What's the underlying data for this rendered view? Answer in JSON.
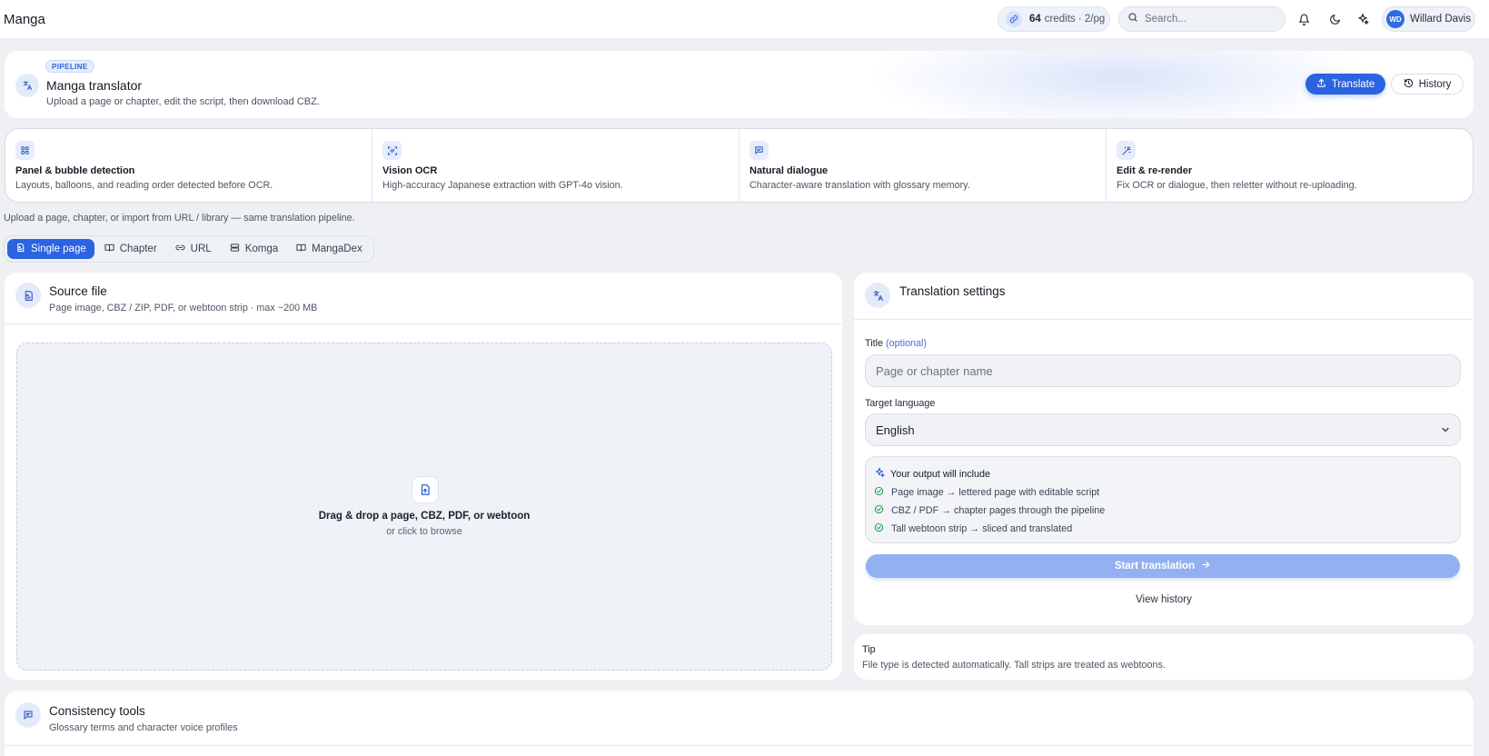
{
  "app": {
    "brand": "Manga"
  },
  "topbar": {
    "credits_value": "64",
    "credits_rest": "credits · 2/pg",
    "search_placeholder": "Search...",
    "user": {
      "initials": "WD",
      "name": "Willard Davis"
    }
  },
  "hero": {
    "badge": "PIPELINE",
    "title": "Manga translator",
    "subtitle": "Upload a page or chapter, edit the script, then download CBZ.",
    "translate_label": "Translate",
    "history_label": "History"
  },
  "features": [
    {
      "title": "Panel & bubble detection",
      "desc": "Layouts, balloons, and reading order detected before OCR.",
      "icon": "grid-icon"
    },
    {
      "title": "Vision OCR",
      "desc": "High-accuracy Japanese extraction with GPT-4o vision.",
      "icon": "scan-text-icon"
    },
    {
      "title": "Natural dialogue",
      "desc": "Character-aware translation with glossary memory.",
      "icon": "message-icon"
    },
    {
      "title": "Edit & re-render",
      "desc": "Fix OCR or dialogue, then reletter without re-uploading.",
      "icon": "wand-icon"
    }
  ],
  "hint": "Upload a page, chapter, or import from URL / library — same translation pipeline.",
  "tabs": [
    {
      "label": "Single page",
      "active": true
    },
    {
      "label": "Chapter",
      "active": false
    },
    {
      "label": "URL",
      "active": false
    },
    {
      "label": "Komga",
      "active": false
    },
    {
      "label": "MangaDex",
      "active": false
    }
  ],
  "source": {
    "title": "Source file",
    "subtitle": "Page image, CBZ / ZIP, PDF, or webtoon strip · max ~200 MB",
    "drop_title": "Drag & drop a page, CBZ, PDF, or webtoon",
    "drop_sub": "or click to browse"
  },
  "settings": {
    "title": "Translation settings",
    "title_label": "Title",
    "title_optional": "(optional)",
    "title_placeholder": "Page or chapter name",
    "language_label": "Target language",
    "language_value": "English",
    "output_title": "Your output will include",
    "output_items": [
      "Page image → lettered page with editable script",
      "CBZ / PDF → chapter pages through the pipeline",
      "Tall webtoon strip → sliced and translated"
    ],
    "start_label": "Start translation",
    "view_history": "View history"
  },
  "tip": {
    "title": "Tip",
    "text": "File type is detected automatically. Tall strips are treated as webtoons."
  },
  "consistency": {
    "title": "Consistency tools",
    "subtitle": "Glossary terms and character voice profiles"
  },
  "colors": {
    "accent": "#2b63e1",
    "accent_disabled": "#93b0f0",
    "page_bg": "#eef0f4"
  }
}
